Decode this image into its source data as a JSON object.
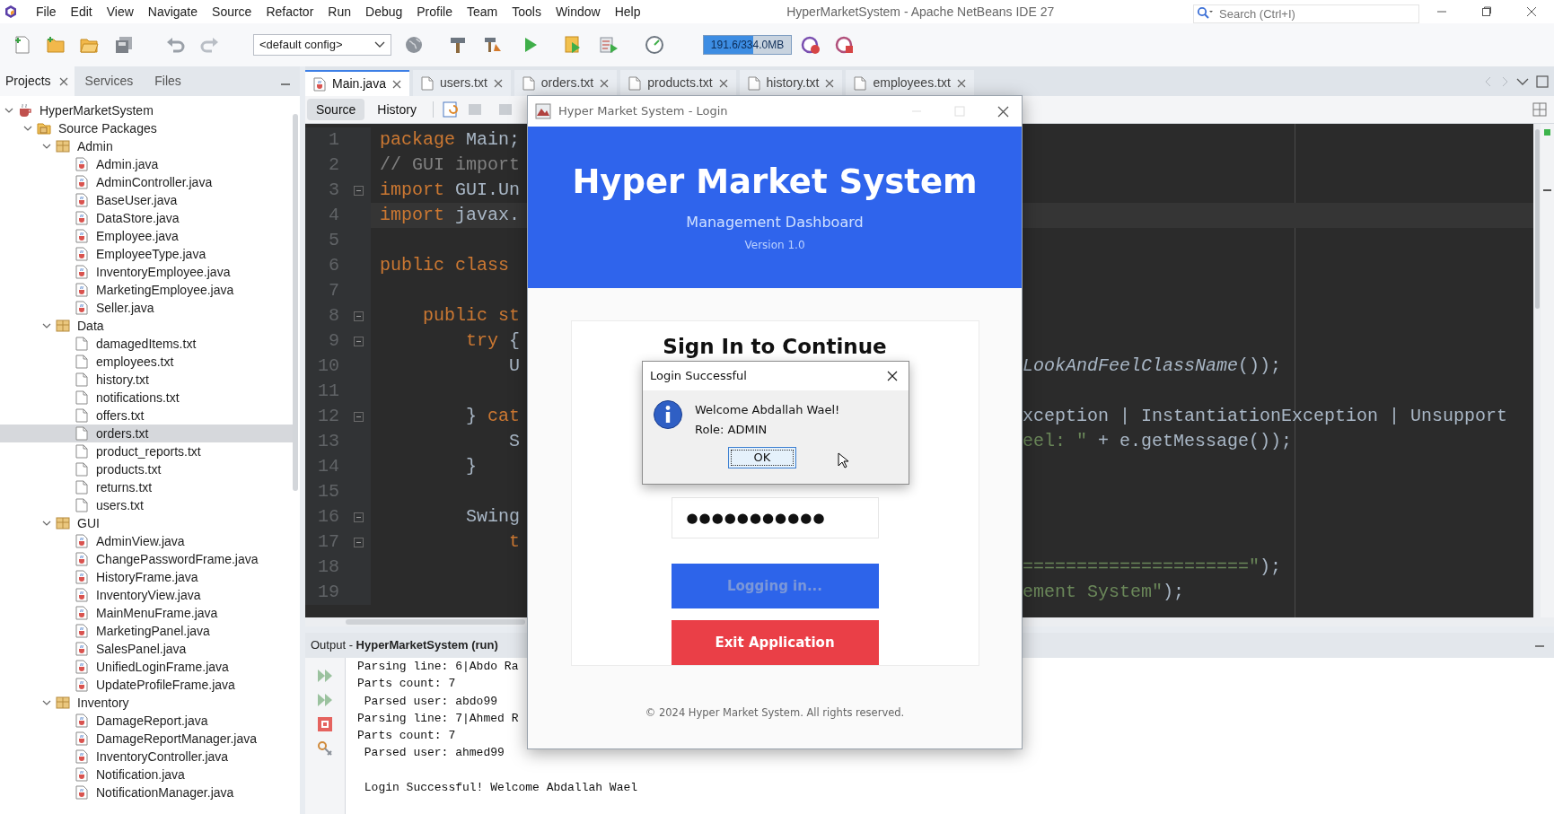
{
  "menu": [
    "File",
    "Edit",
    "View",
    "Navigate",
    "Source",
    "Refactor",
    "Run",
    "Debug",
    "Profile",
    "Team",
    "Tools",
    "Window",
    "Help"
  ],
  "window": {
    "title": "HyperMarketSystem - Apache NetBeans IDE 27"
  },
  "search": {
    "placeholder": "Search (Ctrl+I)"
  },
  "toolbar": {
    "config": "<default config>",
    "memory": {
      "reading": "191.6/334.0MB",
      "level": 0.57
    }
  },
  "side_tabs": [
    {
      "label": "Projects",
      "selected": true,
      "closable": true
    },
    {
      "label": "Services",
      "selected": false,
      "closable": false
    },
    {
      "label": "Files",
      "selected": false,
      "closable": false
    }
  ],
  "project_tree": [
    {
      "label": "HyperMarketSystem",
      "kind": "project",
      "expanded": true,
      "selected": false,
      "children": [
        {
          "label": "Source Packages",
          "kind": "source-root",
          "expanded": true,
          "selected": false,
          "children": [
            {
              "label": "Admin",
              "kind": "package",
              "expanded": true,
              "selected": false,
              "children": [
                {
                  "label": "Admin.java",
                  "kind": "java",
                  "selected": false
                },
                {
                  "label": "AdminController.java",
                  "kind": "java",
                  "selected": false
                },
                {
                  "label": "BaseUser.java",
                  "kind": "java",
                  "selected": false
                },
                {
                  "label": "DataStore.java",
                  "kind": "java",
                  "selected": false
                },
                {
                  "label": "Employee.java",
                  "kind": "java",
                  "selected": false
                },
                {
                  "label": "EmployeeType.java",
                  "kind": "java",
                  "selected": false
                },
                {
                  "label": "InventoryEmployee.java",
                  "kind": "java",
                  "selected": false
                },
                {
                  "label": "MarketingEmployee.java",
                  "kind": "java",
                  "selected": false
                },
                {
                  "label": "Seller.java",
                  "kind": "java",
                  "selected": false
                }
              ]
            },
            {
              "label": "Data",
              "kind": "package",
              "expanded": true,
              "selected": false,
              "children": [
                {
                  "label": "damagedItems.txt",
                  "kind": "text",
                  "selected": false
                },
                {
                  "label": "employees.txt",
                  "kind": "text",
                  "selected": false
                },
                {
                  "label": "history.txt",
                  "kind": "text",
                  "selected": false
                },
                {
                  "label": "notifications.txt",
                  "kind": "text",
                  "selected": false
                },
                {
                  "label": "offers.txt",
                  "kind": "text",
                  "selected": false
                },
                {
                  "label": "orders.txt",
                  "kind": "text",
                  "selected": true
                },
                {
                  "label": "product_reports.txt",
                  "kind": "text",
                  "selected": false
                },
                {
                  "label": "products.txt",
                  "kind": "text",
                  "selected": false
                },
                {
                  "label": "returns.txt",
                  "kind": "text",
                  "selected": false
                },
                {
                  "label": "users.txt",
                  "kind": "text",
                  "selected": false
                }
              ]
            },
            {
              "label": "GUI",
              "kind": "package",
              "expanded": true,
              "selected": false,
              "children": [
                {
                  "label": "AdminView.java",
                  "kind": "java",
                  "selected": false
                },
                {
                  "label": "ChangePasswordFrame.java",
                  "kind": "java",
                  "selected": false
                },
                {
                  "label": "HistoryFrame.java",
                  "kind": "java",
                  "selected": false
                },
                {
                  "label": "InventoryView.java",
                  "kind": "java",
                  "selected": false
                },
                {
                  "label": "MainMenuFrame.java",
                  "kind": "java",
                  "selected": false
                },
                {
                  "label": "MarketingPanel.java",
                  "kind": "java",
                  "selected": false
                },
                {
                  "label": "SalesPanel.java",
                  "kind": "java",
                  "selected": false
                },
                {
                  "label": "UnifiedLoginFrame.java",
                  "kind": "java",
                  "selected": false
                },
                {
                  "label": "UpdateProfileFrame.java",
                  "kind": "java",
                  "selected": false
                }
              ]
            },
            {
              "label": "Inventory",
              "kind": "package",
              "expanded": true,
              "selected": false,
              "children": [
                {
                  "label": "DamageReport.java",
                  "kind": "java",
                  "selected": false
                },
                {
                  "label": "DamageReportManager.java",
                  "kind": "java",
                  "selected": false
                },
                {
                  "label": "InventoryController.java",
                  "kind": "java",
                  "selected": false
                },
                {
                  "label": "Notification.java",
                  "kind": "java",
                  "selected": false
                },
                {
                  "label": "NotificationManager.java",
                  "kind": "java",
                  "selected": false
                }
              ]
            }
          ]
        }
      ]
    }
  ],
  "editor": {
    "tabs": [
      {
        "label": "Main.java",
        "kind": "java",
        "selected": true
      },
      {
        "label": "users.txt",
        "kind": "text",
        "selected": false
      },
      {
        "label": "orders.txt",
        "kind": "text",
        "selected": false
      },
      {
        "label": "products.txt",
        "kind": "text",
        "selected": false
      },
      {
        "label": "history.txt",
        "kind": "text",
        "selected": false
      },
      {
        "label": "employees.txt",
        "kind": "text",
        "selected": false
      }
    ],
    "views": [
      {
        "label": "Source",
        "selected": true
      },
      {
        "label": "History",
        "selected": false
      }
    ],
    "lines": [
      {
        "number": "1",
        "fold": false,
        "highlighted": false,
        "left": [
          {
            "text": "package",
            "kind": "keyword"
          },
          {
            "text": " Main;",
            "kind": "plain"
          }
        ]
      },
      {
        "number": "2",
        "fold": false,
        "highlighted": false,
        "left": [
          {
            "text": "// GUI import",
            "kind": "comment"
          }
        ]
      },
      {
        "number": "3",
        "fold": true,
        "highlighted": false,
        "left": [
          {
            "text": "import",
            "kind": "keyword"
          },
          {
            "text": " GUI.Un",
            "kind": "plain"
          }
        ]
      },
      {
        "number": "4",
        "fold": false,
        "highlighted": true,
        "left": [
          {
            "text": "import",
            "kind": "keyword"
          },
          {
            "text": " javax.",
            "kind": "plain"
          }
        ]
      },
      {
        "number": "5",
        "fold": false,
        "highlighted": false
      },
      {
        "number": "6",
        "fold": false,
        "highlighted": false,
        "left": [
          {
            "text": "public class",
            "kind": "keyword"
          }
        ]
      },
      {
        "number": "7",
        "fold": false,
        "highlighted": false
      },
      {
        "number": "8",
        "fold": true,
        "highlighted": false,
        "left": [
          {
            "text": "    public st",
            "kind": "keyword"
          }
        ]
      },
      {
        "number": "9",
        "fold": true,
        "highlighted": false,
        "left": [
          {
            "text": "        try",
            "kind": "keyword"
          },
          {
            "text": " {",
            "kind": "plain"
          }
        ]
      },
      {
        "number": "10",
        "fold": false,
        "highlighted": false,
        "left": [
          {
            "text": "            U",
            "kind": "plain"
          }
        ],
        "right": [
          {
            "text": "LookAndFeelClassName",
            "kind": "italic"
          },
          {
            "text": "());",
            "kind": "plain"
          }
        ]
      },
      {
        "number": "11",
        "fold": false,
        "highlighted": false
      },
      {
        "number": "12",
        "fold": true,
        "highlighted": false,
        "left": [
          {
            "text": "        } ",
            "kind": "plain"
          },
          {
            "text": "cat",
            "kind": "keyword"
          }
        ],
        "right": [
          {
            "text": "xception | InstantiationException | Unsupport",
            "kind": "plain"
          }
        ]
      },
      {
        "number": "13",
        "fold": false,
        "highlighted": false,
        "left": [
          {
            "text": "            S",
            "kind": "plain"
          }
        ],
        "right": [
          {
            "text": "eel: \"",
            "kind": "string"
          },
          {
            "text": " + e.getMessage());",
            "kind": "plain"
          }
        ]
      },
      {
        "number": "14",
        "fold": false,
        "highlighted": false,
        "left": [
          {
            "text": "        }",
            "kind": "plain"
          }
        ]
      },
      {
        "number": "15",
        "fold": false,
        "highlighted": false
      },
      {
        "number": "16",
        "fold": true,
        "highlighted": false,
        "left": [
          {
            "text": "        Swing",
            "kind": "plain"
          }
        ]
      },
      {
        "number": "17",
        "fold": true,
        "highlighted": false,
        "left": [
          {
            "text": "            t",
            "kind": "keyword"
          }
        ]
      },
      {
        "number": "18",
        "fold": false,
        "highlighted": false,
        "right": [
          {
            "text": "=====================\"",
            "kind": "string"
          },
          {
            "text": ");",
            "kind": "plain"
          }
        ]
      },
      {
        "number": "19",
        "fold": false,
        "highlighted": false,
        "right": [
          {
            "text": "ement System\"",
            "kind": "string"
          },
          {
            "text": ");",
            "kind": "plain"
          }
        ]
      }
    ]
  },
  "output": {
    "title": "Output - **HyperMarketSystem (run)**",
    "line_groups": [
      [
        "Parsing line: 6|Abdo Ra",
        "Parts count: 7",
        " Parsed user: abdo99",
        "Parsing line: 7|Ahmed R",
        "Parts count: 7",
        " Parsed user: ahmed99"
      ],
      [
        " Login Successful! Welcome Abdallah Wael"
      ]
    ]
  },
  "login_window": {
    "title": "Hyper Market System - Login",
    "heading": "Hyper Market System",
    "subtitle": "Management Dashboard",
    "version": "Version 1.0",
    "form_title": "Sign In to Continue",
    "password": "●●●●●●●●●●●",
    "buttons": [
      {
        "label": "Logging in...",
        "kind": "primary",
        "disabled": true
      },
      {
        "label": "Exit Application",
        "kind": "danger",
        "disabled": false
      }
    ],
    "footer": "© 2024 Hyper Market System. All rights reserved."
  },
  "message_dialog": {
    "title": "Login Successful",
    "lines": [
      "Welcome Abdallah Wael!",
      "Role: ADMIN"
    ],
    "button": "OK"
  }
}
